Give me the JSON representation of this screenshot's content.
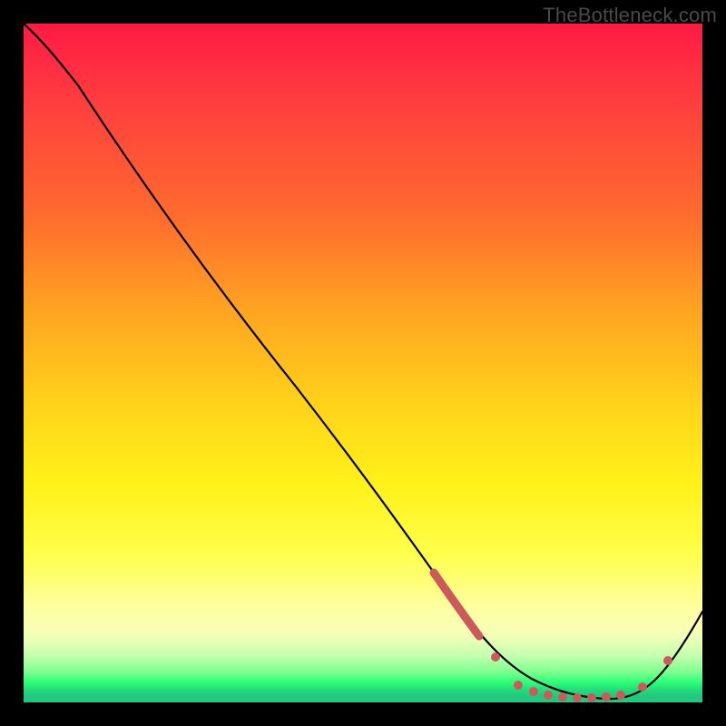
{
  "watermark": "TheBottleneck.com",
  "chart_data": {
    "type": "line",
    "title": "",
    "xlabel": "",
    "ylabel": "",
    "xlim": [
      0,
      100
    ],
    "ylim": [
      0,
      100
    ],
    "series": [
      {
        "name": "bottleneck-curve",
        "x": [
          0,
          4,
          10,
          20,
          30,
          40,
          50,
          58,
          62,
          66,
          70,
          74,
          78,
          82,
          86,
          90,
          94,
          100
        ],
        "y": [
          100,
          97,
          92,
          80,
          68,
          56,
          44,
          33,
          27,
          20,
          13,
          8,
          4,
          1,
          0,
          1,
          5,
          14
        ]
      }
    ],
    "markers": [
      {
        "name": "highlight-descent-segment",
        "x_range": [
          58,
          66
        ],
        "y_range": [
          33,
          20
        ],
        "style": "thick-red-segment"
      },
      {
        "name": "flat-min-cluster",
        "points_x": [
          70,
          73,
          75,
          77,
          79,
          81,
          83,
          85,
          87
        ],
        "points_y": [
          0.8,
          0.4,
          0.3,
          0.3,
          0.3,
          0.3,
          0.3,
          0.4,
          0.6
        ],
        "style": "red-dots"
      },
      {
        "name": "up-dot-1",
        "x": 90,
        "y": 2,
        "style": "red-dot"
      },
      {
        "name": "up-dot-2",
        "x": 93,
        "y": 6,
        "style": "red-dot"
      }
    ],
    "background_gradient": {
      "top": "#ff1a44",
      "mid": "#fff21a",
      "bottom": "#21c97f"
    }
  }
}
